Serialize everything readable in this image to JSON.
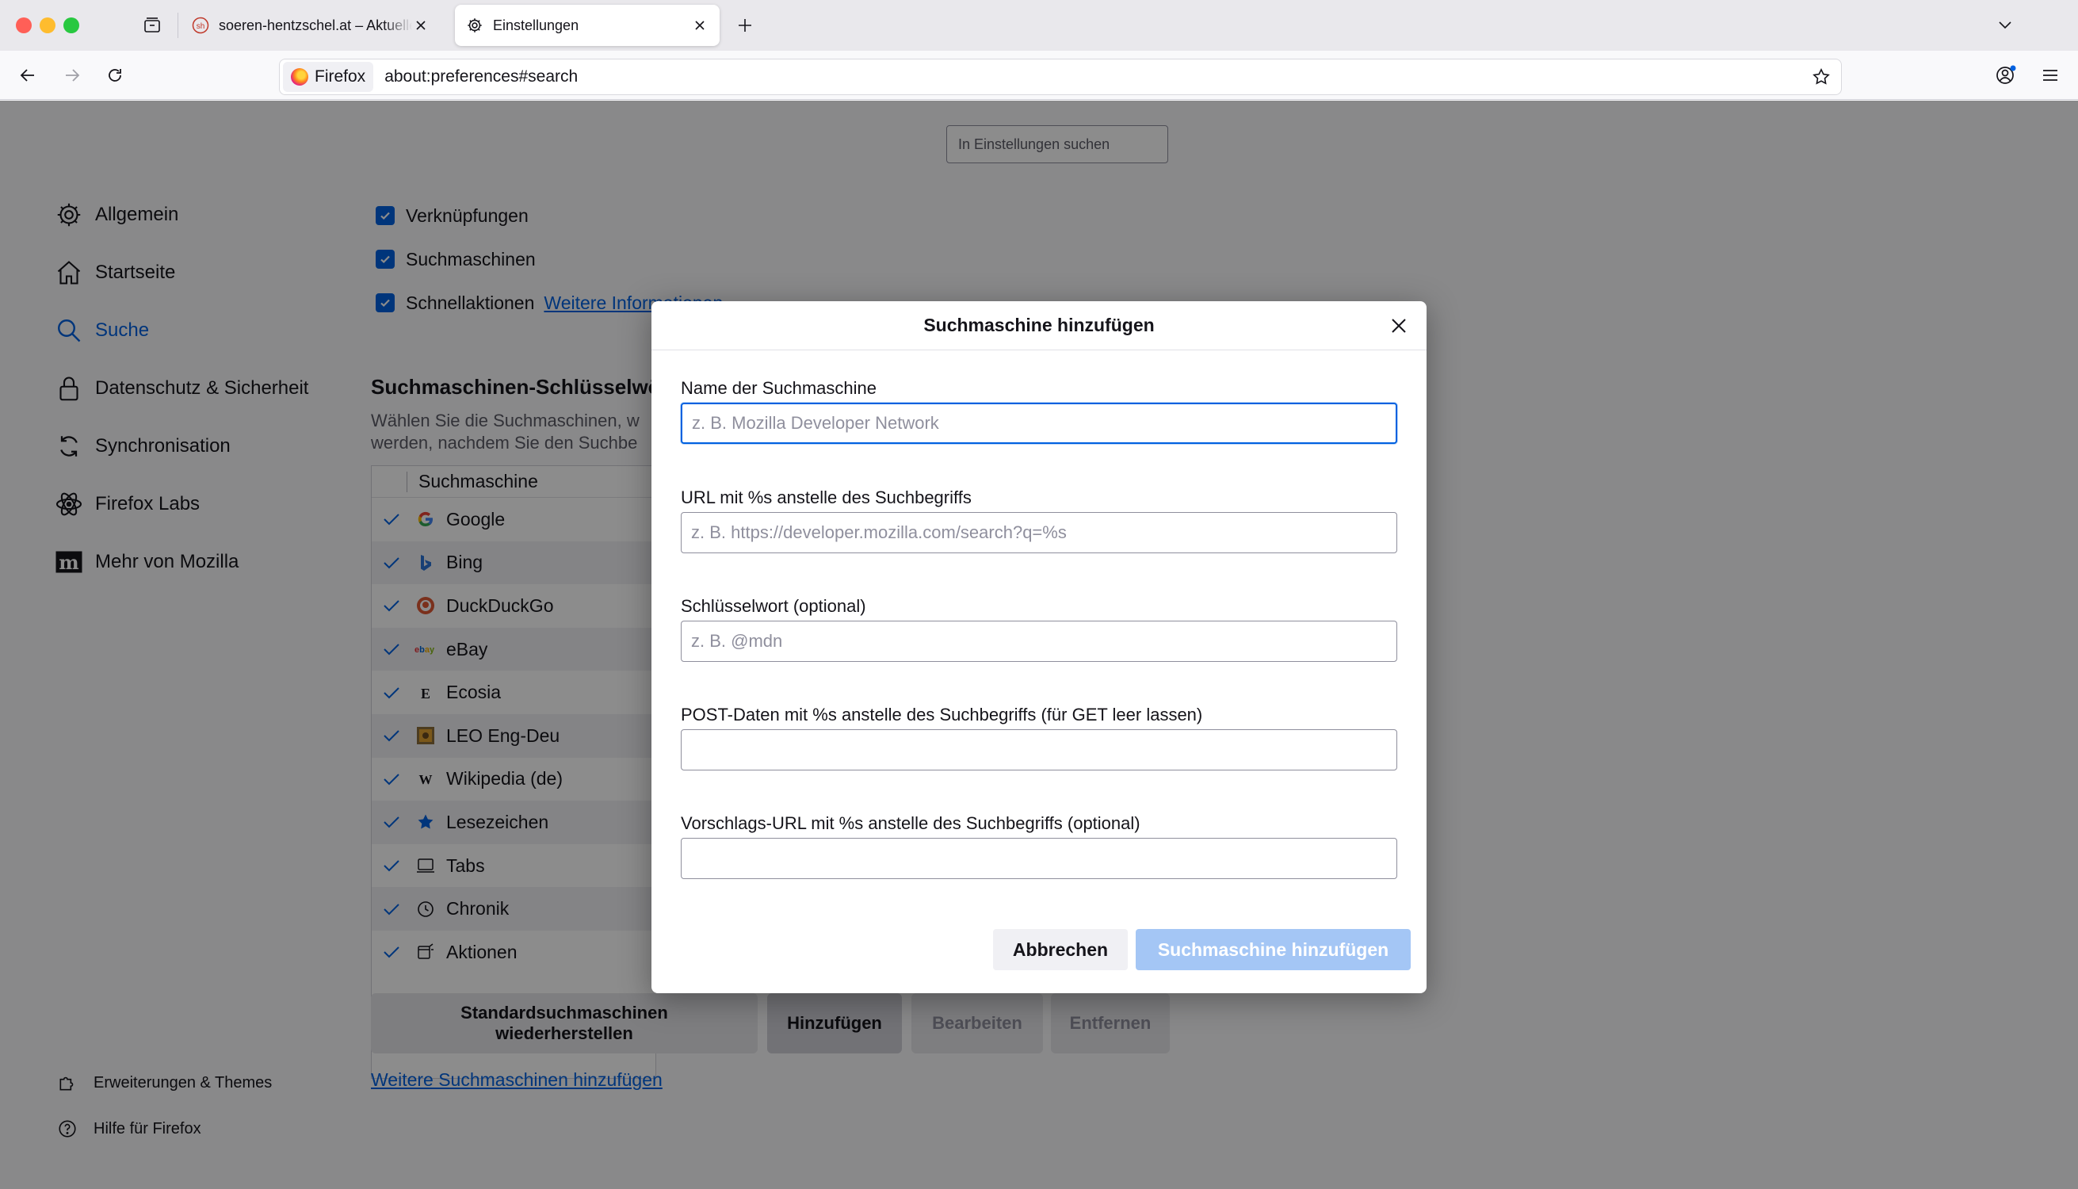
{
  "tabs": [
    {
      "title": "soeren-hentzschel.at – Aktuelle"
    },
    {
      "title": "Einstellungen"
    }
  ],
  "identity_label": "Firefox",
  "url": "about:preferences#search",
  "prefs_search_placeholder": "In Einstellungen suchen",
  "sidebar": {
    "items": [
      {
        "label": "Allgemein",
        "icon": "gear-icon"
      },
      {
        "label": "Startseite",
        "icon": "home-icon"
      },
      {
        "label": "Suche",
        "icon": "search-icon"
      },
      {
        "label": "Datenschutz & Sicherheit",
        "icon": "lock-icon"
      },
      {
        "label": "Synchronisation",
        "icon": "sync-icon"
      },
      {
        "label": "Firefox Labs",
        "icon": "atom-icon"
      },
      {
        "label": "Mehr von Mozilla",
        "icon": "mozilla-icon"
      }
    ],
    "footer": [
      {
        "label": "Erweiterungen & Themes",
        "icon": "puzzle-icon"
      },
      {
        "label": "Hilfe für Firefox",
        "icon": "help-icon"
      }
    ]
  },
  "checkboxes": [
    {
      "label": "Verknüpfungen"
    },
    {
      "label": "Suchmaschinen"
    },
    {
      "label": "Schnellaktionen",
      "link": "Weitere Informationen"
    }
  ],
  "keywords_section": {
    "title": "Suchmaschinen-Schlüsselwörter",
    "desc_line1": "Wählen Sie die Suchmaschinen, w",
    "desc_line2": "werden, nachdem Sie den Suchbe",
    "column_header": "Suchmaschine",
    "engines": [
      "Google",
      "Bing",
      "DuckDuckGo",
      "eBay",
      "Ecosia",
      "LEO Eng-Deu",
      "Wikipedia (de)",
      "Lesezeichen",
      "Tabs",
      "Chronik",
      "Aktionen"
    ],
    "buttons": {
      "restore_line1": "Standardsuchmaschinen",
      "restore_line2": "wiederherstellen",
      "add": "Hinzufügen",
      "edit": "Bearbeiten",
      "remove": "Entfernen"
    },
    "more_link": "Weitere Suchmaschinen hinzufügen"
  },
  "dialog": {
    "title": "Suchmaschine hinzufügen",
    "fields": [
      {
        "label": "Name der Suchmaschine",
        "placeholder": "z. B. Mozilla Developer Network",
        "value": ""
      },
      {
        "label": "URL mit %s anstelle des Suchbegriffs",
        "placeholder": "z. B. https://developer.mozilla.com/search?q=%s",
        "value": ""
      },
      {
        "label": "Schlüsselwort (optional)",
        "placeholder": "z. B. @mdn",
        "value": ""
      },
      {
        "label": "POST-Daten mit %s anstelle des Suchbegriffs (für GET leer lassen)",
        "placeholder": "",
        "value": ""
      },
      {
        "label": "Vorschlags-URL mit %s anstelle des Suchbegriffs (optional)",
        "placeholder": "",
        "value": ""
      }
    ],
    "cancel_label": "Abbrechen",
    "submit_label": "Suchmaschine hinzufügen"
  },
  "colors": {
    "accent": "#0061e0",
    "primary_disabled": "#a4c6f5"
  }
}
